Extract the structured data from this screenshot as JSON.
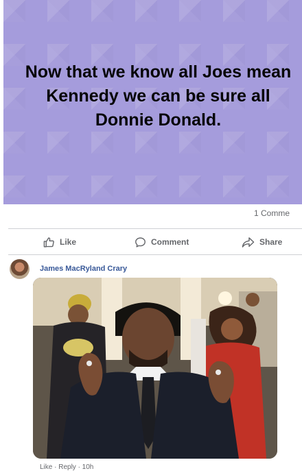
{
  "post": {
    "text": "Now that we know all Joes mean Kennedy we can be sure all Donnie Donald.",
    "comment_count": "1 Comme",
    "background": "#a59cdc"
  },
  "actions": {
    "like": "Like",
    "comment": "Comment",
    "share": "Share"
  },
  "comment": {
    "author": "James MacRyland Crary",
    "media": "gif-image",
    "meta": "Like · Reply · 10h"
  },
  "colors": {
    "link": "#385898",
    "muted": "#65676b",
    "divider": "#ced0d4"
  }
}
